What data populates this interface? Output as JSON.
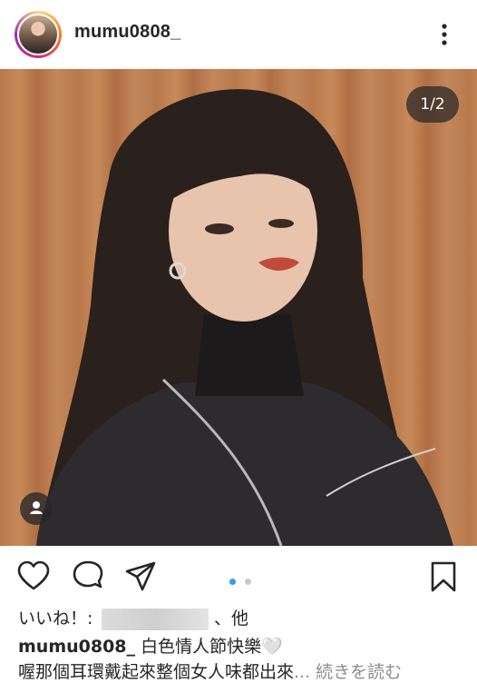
{
  "header": {
    "username": "mumu0808_",
    "avatar_icon": "profile-avatar",
    "more_icon": "more-vertical-icon"
  },
  "post": {
    "image_counter": "1/2",
    "tag_icon": "user-tag-icon",
    "carousel": {
      "current": 1,
      "total": 2,
      "active_color": "#3897f0",
      "inactive_color": "#c7c7c7"
    }
  },
  "actions": {
    "like_icon": "heart-icon",
    "comment_icon": "comment-icon",
    "share_icon": "send-icon",
    "save_icon": "bookmark-icon"
  },
  "likes": {
    "prefix": "いいね！:",
    "suffix": "、他"
  },
  "caption": {
    "username": "mumu0808_",
    "line1_text": " 白色情人節快樂🤍",
    "line2_text": "喔那個耳環戴起來整個女人味都出來",
    "ellipsis": "...",
    "more_label": " 続きを読む"
  }
}
